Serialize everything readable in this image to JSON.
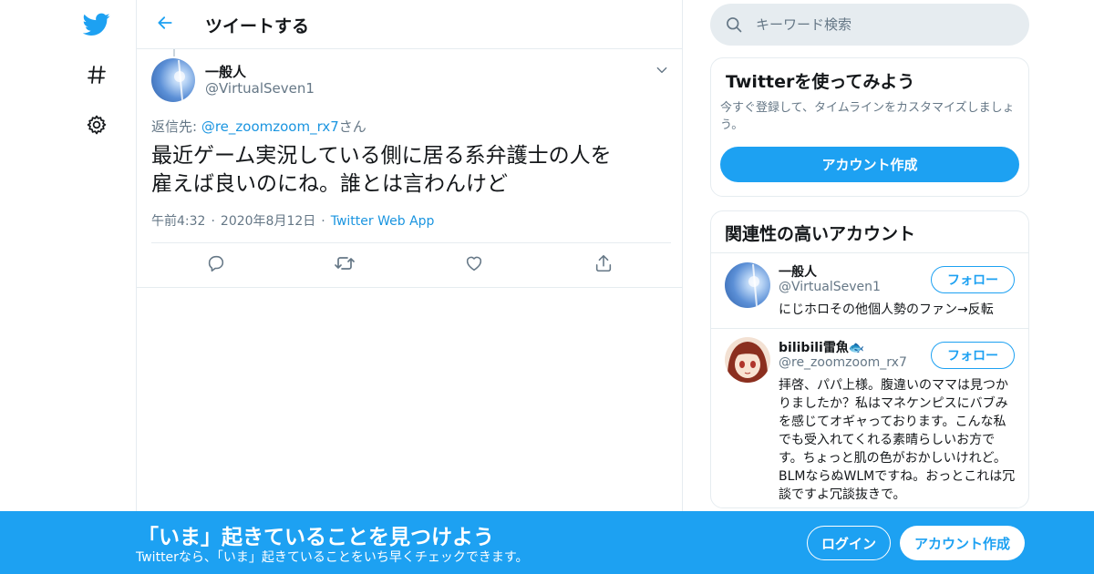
{
  "colors": {
    "accent": "#1da1f2",
    "link": "#1b95e0",
    "secondary_text": "#657786",
    "border": "#e6ecf0"
  },
  "nav": {
    "icons": [
      "twitter-logo-icon",
      "hashtag-icon",
      "gear-icon"
    ]
  },
  "header": {
    "back_icon": "arrow-left-icon",
    "title": "ツイートする"
  },
  "tweet": {
    "name": "一般人",
    "handle": "@VirtualSeven1",
    "reply_label": "返信先: ",
    "reply_mention": "@re_zoomzoom_rx7",
    "reply_suffix": "さん",
    "text_line1": "最近ゲーム実況している側に居る系弁護士の人を",
    "text_line2": "雇えば良いのにね。誰とは言わんけど",
    "time": "午前4:32",
    "date": "2020年8月12日",
    "app": "Twitter Web App",
    "actions": [
      "reply-icon",
      "retweet-icon",
      "like-icon",
      "share-icon"
    ]
  },
  "sidebar": {
    "search": {
      "placeholder": "キーワード検索"
    },
    "signup_card": {
      "title": "Twitterを使ってみよう",
      "description": "今すぐ登録して、タイムラインをカスタマイズしましょう。",
      "button": "アカウント作成"
    },
    "related": {
      "title": "関連性の高いアカウント",
      "accounts": [
        {
          "name": "一般人",
          "handle": "@VirtualSeven1",
          "bio": "にじホロその他個人勢のファン→反転",
          "follow": "フォロー"
        },
        {
          "name": "bilibili雷魚🐟",
          "handle": "@re_zoomzoom_rx7",
          "bio": "拝啓、パパ上様。腹違いのママは見つかりましたか？私はマネケンピスにバブみを感じてオギャっております。こんな私でも受入れてくれる素晴らしいお方です。ちょっと肌の色がおかしいけれど。BLMならぬWLMですね。おっとこれは冗談ですよ冗談抜きで。",
          "follow": "フォロー"
        }
      ]
    }
  },
  "bottom_bar": {
    "title": "「いま」起きていることを見つけよう",
    "subtitle": "Twitterなら、「いま」起きていることをいち早くチェックできます。",
    "login": "ログイン",
    "signup": "アカウント作成"
  }
}
